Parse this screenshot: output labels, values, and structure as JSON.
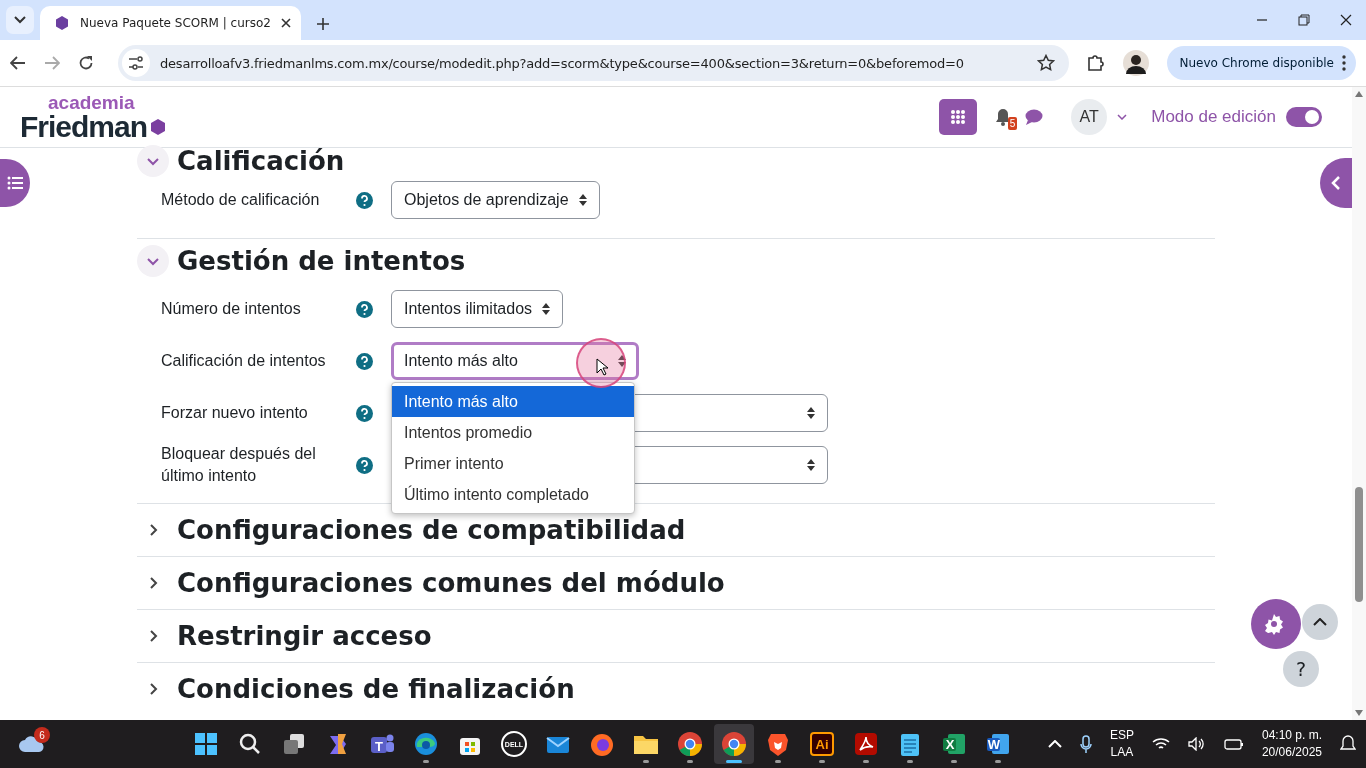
{
  "browser": {
    "tab_title": "Nueva Paquete SCORM | curso2",
    "url": "desarrolloafv3.friedmanlms.com.mx/course/modedit.php?add=scorm&type&course=400&section=3&return=0&beforemod=0",
    "update_button": "Nuevo Chrome disponible"
  },
  "header": {
    "logo_top": "academia",
    "logo_main": "Friedman",
    "notification_count": "5",
    "avatar": "AT",
    "edit_mode": {
      "label": "Modo de edición",
      "on": true
    }
  },
  "sections": [
    {
      "title": "Calificación",
      "expanded": true,
      "fields": [
        {
          "label": "Método de calificación",
          "value": "Objetos de aprendizaje",
          "focused": false
        }
      ]
    },
    {
      "title": "Gestión de intentos",
      "expanded": true,
      "fields": [
        {
          "label": "Número de intentos",
          "value": "Intentos ilimitados",
          "focused": false
        },
        {
          "label": "Calificación de intentos",
          "value": "Intento más alto",
          "focused": true,
          "options": [
            {
              "label": "Intento más alto",
              "selected": true
            },
            {
              "label": "Intentos promedio",
              "selected": false
            },
            {
              "label": "Primer intento",
              "selected": false
            },
            {
              "label": "Último intento completado",
              "selected": false
            }
          ]
        },
        {
          "label": "Forzar nuevo intento",
          "focused": false
        },
        {
          "label": "Bloquear después del último intento",
          "focused": false
        }
      ]
    },
    {
      "title": "Configuraciones de compatibilidad",
      "expanded": false
    },
    {
      "title": "Configuraciones comunes del módulo",
      "expanded": false
    },
    {
      "title": "Restringir acceso",
      "expanded": false
    },
    {
      "title": "Condiciones de finalización",
      "expanded": false
    }
  ],
  "taskbar": {
    "weather_badge": "6",
    "apps": [
      {
        "kind": "start",
        "running": false
      },
      {
        "kind": "search",
        "running": false
      },
      {
        "kind": "taskview",
        "running": false
      },
      {
        "kind": "copilot",
        "running": false
      },
      {
        "kind": "teams",
        "glyph": "T",
        "running": false
      },
      {
        "kind": "edge",
        "running": true
      },
      {
        "kind": "store",
        "running": false
      },
      {
        "kind": "dell",
        "glyph": "DELL",
        "running": false
      },
      {
        "kind": "mail",
        "running": false
      },
      {
        "kind": "firefox",
        "running": false
      },
      {
        "kind": "folder",
        "running": true
      },
      {
        "kind": "chrome",
        "running": true
      },
      {
        "kind": "chrome",
        "running": true,
        "selected": true
      },
      {
        "kind": "brave",
        "running": true
      },
      {
        "kind": "illustrator",
        "glyph": "Ai",
        "running": true
      },
      {
        "kind": "acrobat",
        "running": true
      },
      {
        "kind": "notepad",
        "running": true
      },
      {
        "kind": "excel",
        "glyph": "X",
        "running": true
      },
      {
        "kind": "word",
        "glyph": "W",
        "running": true
      }
    ],
    "help_button": "?",
    "language": "ESP",
    "layout": "LAA",
    "time": "04:10 p. m.",
    "date": "20/06/2025"
  }
}
